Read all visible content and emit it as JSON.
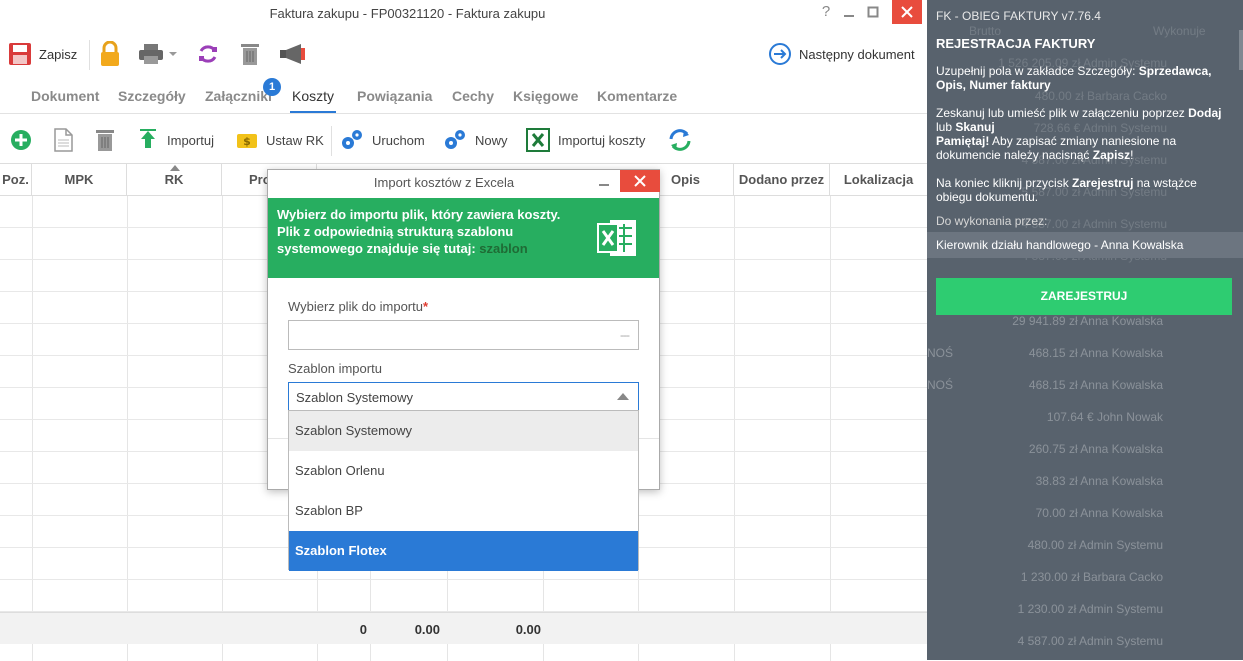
{
  "window": {
    "title": "Faktura zakupu - FP00321120 - Faktura zakupu",
    "help": "?",
    "minimize": "_",
    "maximize": "▢",
    "close": "✕"
  },
  "toolbar": {
    "save_label": "Zapisz",
    "next_label": "Następny dokument"
  },
  "tabs": [
    {
      "label": "Dokument"
    },
    {
      "label": "Szczegóły"
    },
    {
      "label": "Załączniki"
    },
    {
      "label": "Koszty"
    },
    {
      "label": "Powiązania"
    },
    {
      "label": "Cechy"
    },
    {
      "label": "Księgowe"
    },
    {
      "label": "Komentarze"
    }
  ],
  "attachments_badge": "1",
  "costs_toolbar": {
    "import_label": "Importuj",
    "set_rk_label": "Ustaw RK",
    "run_label": "Uruchom",
    "new_label": "Nowy",
    "import_costs_label": "Importuj koszty"
  },
  "grid": {
    "columns": [
      "Poz.",
      "MPK",
      "RK",
      "Pro",
      "",
      "",
      "",
      "Opis",
      "Dodano przez",
      "Lokalizacja"
    ],
    "totals": [
      "0",
      "0.00",
      "0.00"
    ]
  },
  "panel": {
    "header": "FK - OBIEG FAKTURY v7.76.4",
    "section_title": "REJESTRACJA FAKTURY",
    "para1_plain": "Uzupełnij pola w zakładce Szczegóły: ",
    "para1_bold": "Sprzedawca, Opis, Numer faktury",
    "para2_a": "Zeskanuj lub umieść plik w załączeniu poprzez ",
    "para2_b": "Dodaj",
    "para2_c": " lub ",
    "para2_d": "Skanuj",
    "para3_a": "Pamiętaj!",
    "para3_b": " Aby zapisać zmiany naniesione na dokumencie należy nacisnąć ",
    "para3_c": "Zapisz",
    "para3_d": "!",
    "para4_a": "Na koniec kliknij przycisk ",
    "para4_b": "Zarejestruj",
    "para4_c": " na wstążce obiegu dokumentu.",
    "todo_label": "Do wykonania przez:",
    "assignee": "Kierownik działu handlowego - Anna Kowalska",
    "register_button": "ZAREJESTRUJ",
    "bg_headers": [
      "Brutto",
      "Wykonuje"
    ],
    "bg_rows": [
      "1 526 205.09 zł Admin Systemu",
      "480.00 zł Barbara Cacko",
      "728.66 € Admin Systemu",
      "4 587.00 zł Admin Systemu",
      "5 587.00 zł Admin Systemu",
      "4 587.00 zł Admin Systemu",
      "4 587.00 zł Admin Systemu",
      "29 941.89 zł Anna Kowalska",
      "468.15 zł Anna Kowalska",
      "468.15 zł Anna Kowalska",
      "107.64 € John Nowak",
      "260.75 zł Anna Kowalska",
      "38.83 zł Anna Kowalska",
      "70.00 zł Anna Kowalska",
      "480.00 zł Admin Systemu",
      "1 230.00 zł Barbara Cacko",
      "1 230.00 zł Admin Systemu",
      "4 587.00 zł Admin Systemu"
    ],
    "bg_fragment": "NOŚ"
  },
  "dialog": {
    "title": "Import kosztów z Excela",
    "banner_text": "Wybierz do importu plik, który zawiera koszty. Plik z odpowiednią strukturą szablonu systemowego znajduje się tutaj: ",
    "banner_link": "szablon",
    "file_label": "Wybierz plik do importu",
    "file_value": "",
    "file_button": "---",
    "template_label": "Szablon importu",
    "template_value": "Szablon Systemowy",
    "options": [
      {
        "label": "Szablon Systemowy",
        "state": "hover"
      },
      {
        "label": "Szablon Orlenu",
        "state": "normal"
      },
      {
        "label": "Szablon BP",
        "state": "normal"
      },
      {
        "label": "Szablon Flotex",
        "state": "selected"
      }
    ]
  },
  "colors": {
    "accent": "#2a7ad6",
    "banner": "#27ae60",
    "register": "#2ecc71",
    "panel": "#58626d",
    "close": "#e84c3d"
  }
}
